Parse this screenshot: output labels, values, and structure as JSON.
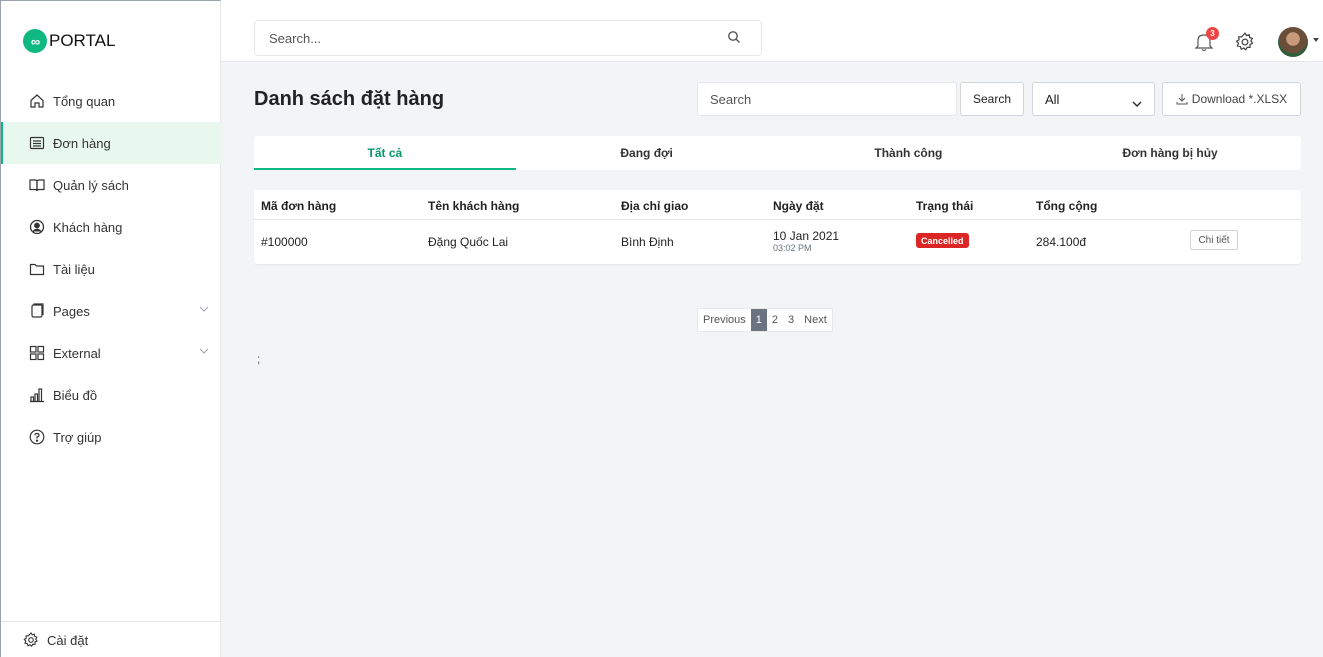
{
  "app": {
    "logo_symbol": "∞",
    "logo_text": "PORTAL",
    "brand_color": "#10b981"
  },
  "sidebar": {
    "items": [
      {
        "label": "Tổng quan",
        "icon": "home-icon"
      },
      {
        "label": "Đơn hàng",
        "icon": "list-icon",
        "active": true
      },
      {
        "label": "Quản lý sách",
        "icon": "book-icon"
      },
      {
        "label": "Khách hàng",
        "icon": "user-circle-icon"
      },
      {
        "label": "Tài liệu",
        "icon": "folder-icon"
      },
      {
        "label": "Pages",
        "icon": "pages-icon",
        "expandable": true
      },
      {
        "label": "External",
        "icon": "grid-icon",
        "expandable": true
      },
      {
        "label": "Biểu đồ",
        "icon": "bar-chart-icon"
      },
      {
        "label": "Trợ giúp",
        "icon": "help-icon"
      }
    ],
    "settings_label": "Cài đặt"
  },
  "header": {
    "search_placeholder": "Search...",
    "notification_count": "3"
  },
  "main": {
    "title": "Danh sách đặt hàng",
    "search_placeholder": "Search",
    "search_button": "Search",
    "filter_value": "All",
    "download_label": "Download *.XLSX",
    "tabs": [
      {
        "label": "Tất cả",
        "active": true
      },
      {
        "label": "Đang đợi"
      },
      {
        "label": "Thành công"
      },
      {
        "label": "Đơn hàng bị hủy"
      }
    ],
    "table": {
      "headers": [
        "Mã đơn hàng",
        "Tên khách hàng",
        "Địa chỉ giao",
        "Ngày đặt",
        "Trạng thái",
        "Tổng cộng"
      ],
      "rows": [
        {
          "order_id": "#100000",
          "customer": "Đặng Quốc Lai",
          "address": "Bình Định",
          "date": "10 Jan 2021",
          "time": "03:02 PM",
          "status": "Cancelled",
          "status_color": "#dc2626",
          "total": "284.100đ",
          "action": "Chi tiết"
        }
      ]
    },
    "pagination": {
      "previous": "Previous",
      "pages": [
        "1",
        "2",
        "3"
      ],
      "current": "1",
      "next": "Next"
    },
    "stray_text": ";"
  }
}
